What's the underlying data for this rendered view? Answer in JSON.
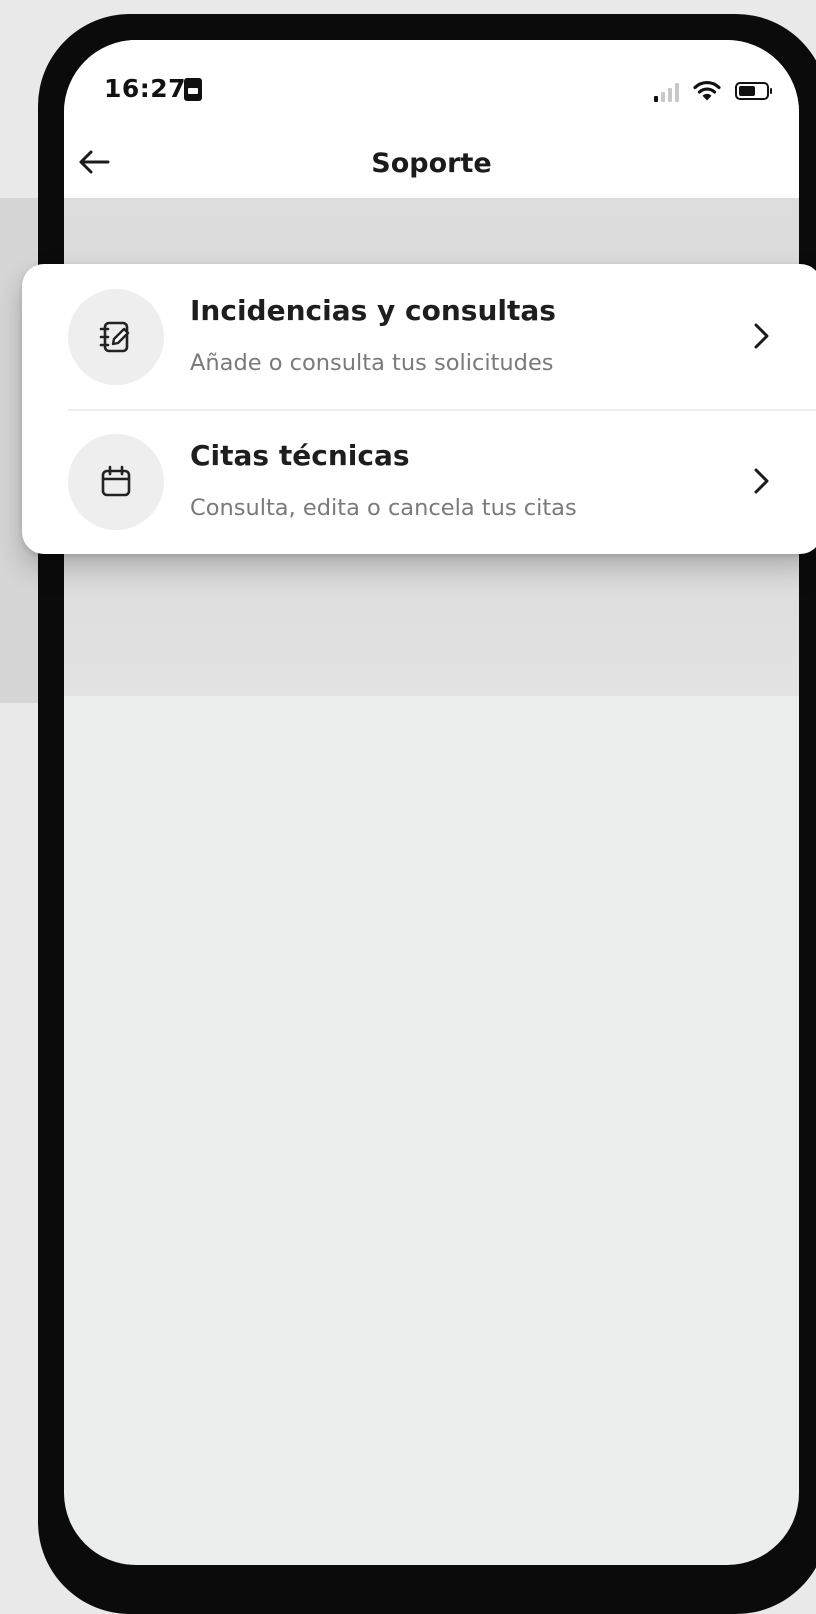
{
  "status_bar": {
    "time": "16:27",
    "icons": [
      "sim-card-icon",
      "signal-icon",
      "wifi-icon",
      "battery-icon"
    ],
    "battery_level": 0.6
  },
  "nav": {
    "title": "Soporte",
    "back_icon": "arrow-left-icon"
  },
  "menu": {
    "items": [
      {
        "icon": "edit-notebook-icon",
        "title": "Incidencias y consultas",
        "subtitle": "Añade o consulta tus solicitudes"
      },
      {
        "icon": "calendar-icon",
        "title": "Citas técnicas",
        "subtitle": "Consulta, edita o cancela tus citas"
      }
    ]
  },
  "colors": {
    "background": "#eceeed",
    "card": "#ffffff",
    "title_text": "#1e1e1e",
    "subtitle_text": "#7a7a7a"
  }
}
